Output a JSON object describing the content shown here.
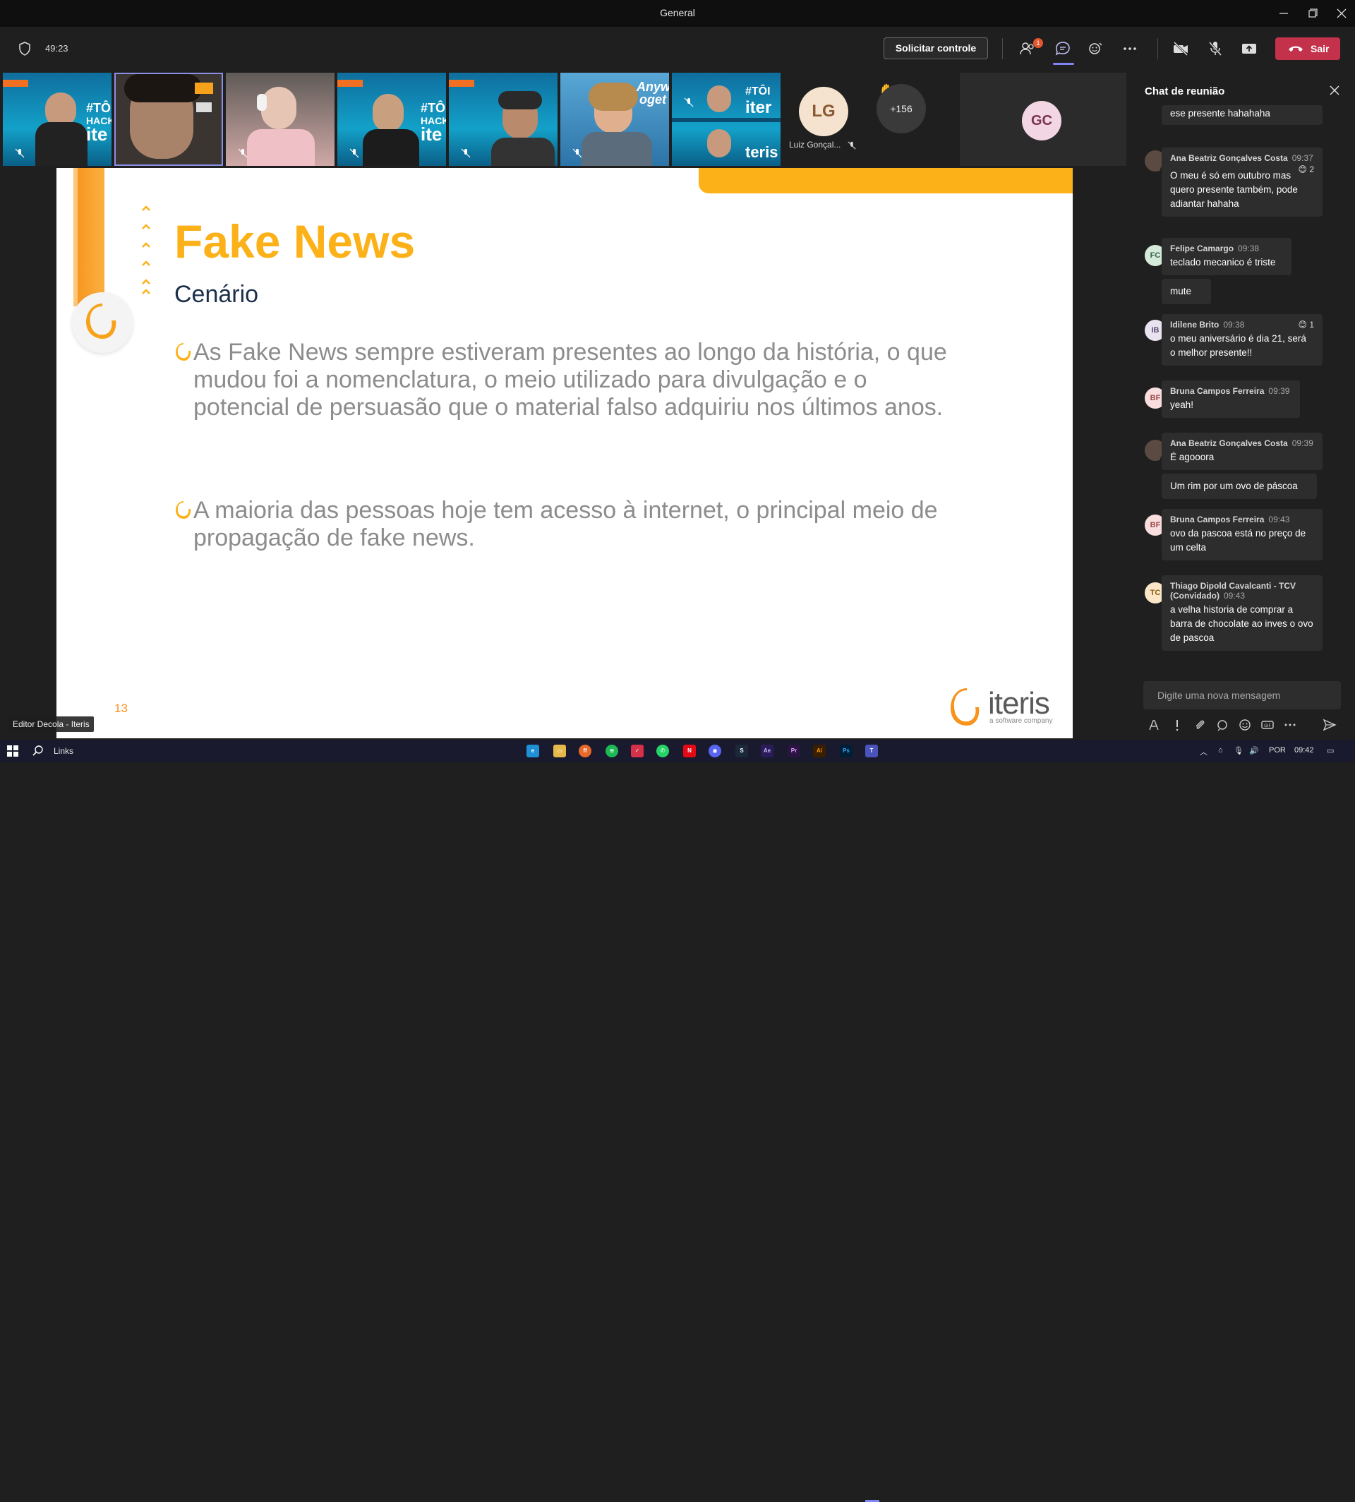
{
  "window": {
    "title": "General",
    "controls": [
      "minimize-icon",
      "restore-icon",
      "close-icon"
    ]
  },
  "toolbar": {
    "timer": "49:23",
    "request_control_label": "Solicitar controle",
    "participants_badge": "1",
    "leave_label": "Sair",
    "icons": [
      "shield-icon",
      "people-icon",
      "chat-icon",
      "reactions-icon",
      "more-icon",
      "camera-off-icon",
      "mic-off-icon",
      "share-icon",
      "phone-icon"
    ]
  },
  "videos": {
    "lg": {
      "initials": "LG",
      "name": "Luiz Gonçal..."
    },
    "more_count": "+156",
    "gc": {
      "initials": "GC"
    }
  },
  "slide": {
    "title": "Fake News",
    "subtitle": "Cenário",
    "bullets": [
      "As Fake News sempre estiveram presentes ao longo da história, o que mudou foi a nomenclatura, o meio utilizado para divulgação e o potencial de persuasão que o material falso adquiriu nos últimos anos.",
      "A maioria das pessoas hoje tem acesso à internet, o principal meio de propagação de fake news."
    ],
    "page_number": "13",
    "logo_word": "iteris",
    "logo_tagline": "a software company",
    "presenter_label": "Editor Decola - Iteris"
  },
  "chat": {
    "header": "Chat de reunião",
    "partial_message": "ese presente hahahaha",
    "messages": [
      {
        "initials": "",
        "author": "Ana Beatriz Gonçalves Costa",
        "time": "09:37",
        "reaction": "😊 2",
        "lines": [
          "O meu é só em outubro mas quero presente também, pode adiantar hahaha"
        ]
      },
      {
        "initials": "FC",
        "author": "Felipe Camargo",
        "time": "09:38",
        "reaction": "",
        "lines": [
          "teclado mecanico é triste"
        ],
        "followup": "mute"
      },
      {
        "initials": "IB",
        "author": "Idilene Brito",
        "time": "09:38",
        "reaction": "😊 1",
        "lines": [
          "o meu aniversário é dia 21, será o melhor presente!!"
        ]
      },
      {
        "initials": "BF",
        "author": "Bruna Campos Ferreira",
        "time": "09:39",
        "reaction": "",
        "lines": [
          "yeah!"
        ]
      },
      {
        "initials": "",
        "author": "Ana Beatriz Gonçalves Costa",
        "time": "09:39",
        "reaction": "",
        "lines": [
          "É agooora"
        ],
        "followup": "Um rim por um ovo de páscoa"
      },
      {
        "initials": "BF",
        "author": "Bruna Campos Ferreira",
        "time": "09:43",
        "reaction": "",
        "lines": [
          "ovo da pascoa está no preço de um celta"
        ]
      },
      {
        "initials": "TC",
        "author": "Thiago Dipold Cavalcanti - TCV (Convidado)",
        "time": "09:43",
        "reaction": "",
        "lines": [
          "a velha historia de comprar a barra de chocolate ao inves o ovo de pascoa"
        ]
      }
    ],
    "input_placeholder": "Digite uma nova mensagem"
  },
  "taskbar": {
    "links_label": "Links",
    "language": "POR",
    "clock": "09:42"
  },
  "colors": {
    "accent_orange": "#fbb117",
    "leave_red": "#c4314b",
    "teams_purple": "#7f85f5"
  }
}
